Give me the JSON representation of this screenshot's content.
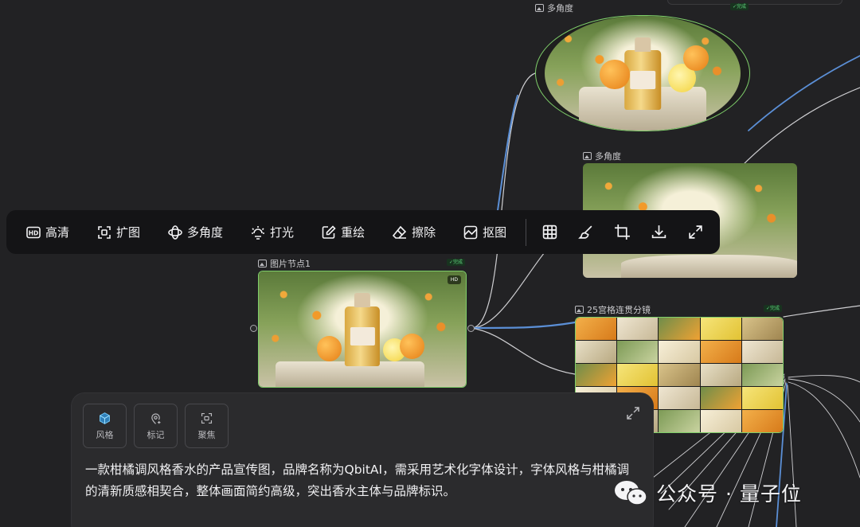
{
  "nodes": {
    "top": {
      "title": "多角度",
      "status": "✓完成"
    },
    "middle": {
      "title": "多角度"
    },
    "selected": {
      "title": "图片节点1",
      "status": "✓完成",
      "hd_tag": "HD"
    },
    "grid": {
      "title": "25宫格连贯分镜",
      "status": "✓完成"
    }
  },
  "toolbar": {
    "hd": "高清",
    "expand": "扩图",
    "angle": "多角度",
    "light": "打光",
    "redraw": "重绘",
    "erase": "擦除",
    "cutout": "抠图",
    "icons": [
      "grid-icon",
      "brush-icon",
      "crop-icon",
      "download-icon",
      "fullscreen-icon"
    ]
  },
  "panel": {
    "chips": [
      {
        "label": "风格",
        "icon": "cube-icon",
        "active": true
      },
      {
        "label": "标记",
        "icon": "pin-icon"
      },
      {
        "label": "聚焦",
        "icon": "focus-icon"
      }
    ],
    "prompt": "一款柑橘调风格香水的产品宣传图，品牌名称为QbitAI，需采用艺术化字体设计，字体风格与柑橘调的清新质感相契合，整体画面简约高级，突出香水主体与品牌标识。"
  },
  "watermark": "公众号 · 量子位",
  "colors": {
    "canvas": "#222224",
    "toolbar": "#141416",
    "panel": "#2b2b2d",
    "selected_border": "#7fcf6a",
    "edge_blue": "#5b8fd6",
    "status_green": "#5fd47c"
  }
}
